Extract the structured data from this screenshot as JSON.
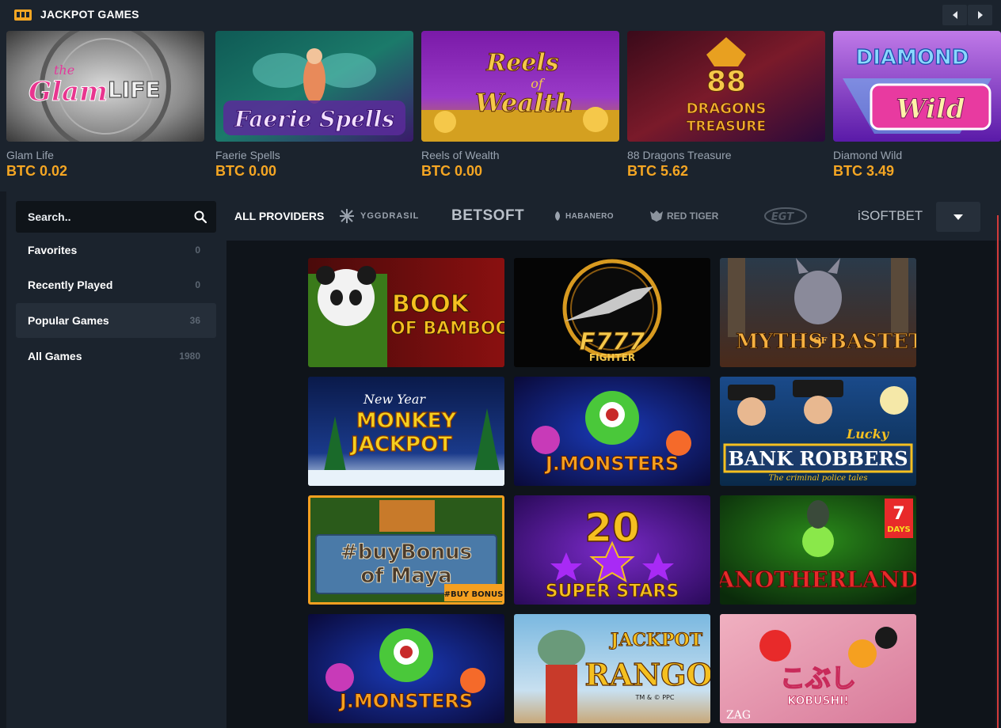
{
  "jackpot": {
    "title": "JACKPOT GAMES",
    "games": [
      {
        "name": "Glam Life",
        "value": "BTC 0.02",
        "art_top": "the",
        "art_main": "Glam",
        "art_sub": "LIFE"
      },
      {
        "name": "Faerie Spells",
        "value": "BTC 0.00",
        "art_main": "Faerie Spells"
      },
      {
        "name": "Reels of Wealth",
        "value": "BTC 0.00",
        "art_top": "Reels",
        "art_mid": "of",
        "art_main": "Wealth"
      },
      {
        "name": "88 Dragons Treasure",
        "value": "BTC 5.62",
        "art_top": "88",
        "art_main": "DRAGONS",
        "art_sub": "TREASURE"
      },
      {
        "name": "Diamond Wild",
        "value": "BTC 3.49",
        "art_top": "DIAMOND",
        "art_main": "Wild"
      }
    ]
  },
  "sidebar": {
    "search_placeholder": "Search..",
    "items": [
      {
        "label": "Favorites",
        "count": "0"
      },
      {
        "label": "Recently Played",
        "count": "0"
      },
      {
        "label": "Popular Games",
        "count": "36"
      },
      {
        "label": "All Games",
        "count": "1980"
      }
    ]
  },
  "providers": {
    "all": "ALL PROVIDERS",
    "yggdrasil": "YGGDRASIL",
    "betsoft": "BETSOFT",
    "habanero": "HABANERO",
    "redtiger": "RED TIGER",
    "egt": "EGT",
    "isoftbet": "iSOFTBET"
  },
  "games": [
    {
      "l1": "BOOK",
      "l2": "OF BAMBOO"
    },
    {
      "l1": "F777",
      "l2": "FIGHTER"
    },
    {
      "l1": "MYTHS",
      "l2": "OF",
      "l3": "BASTET"
    },
    {
      "l1": "New Year",
      "l2": "MONKEY",
      "l3": "JACKPOT"
    },
    {
      "l1": "J.MONSTERS"
    },
    {
      "l1": "Lucky",
      "l2": "BANK ROBBERS",
      "l3": "The criminal police tales"
    },
    {
      "l1": "#buyBonus",
      "l2": "of Maya",
      "l3": "#BUY BONUS"
    },
    {
      "l1": "20",
      "l2": "SUPER STARS"
    },
    {
      "l1": "ANOTHERLAND",
      "l2": "7",
      "l3": "DAYS"
    },
    {
      "l1": "J.MONSTERS"
    },
    {
      "l1": "JACKPOT",
      "l2": "RANGO",
      "l3": "TM & © PPC"
    },
    {
      "l1": "こぶし",
      "l2": "KOBUSHI!",
      "l3": "ZAG"
    }
  ]
}
